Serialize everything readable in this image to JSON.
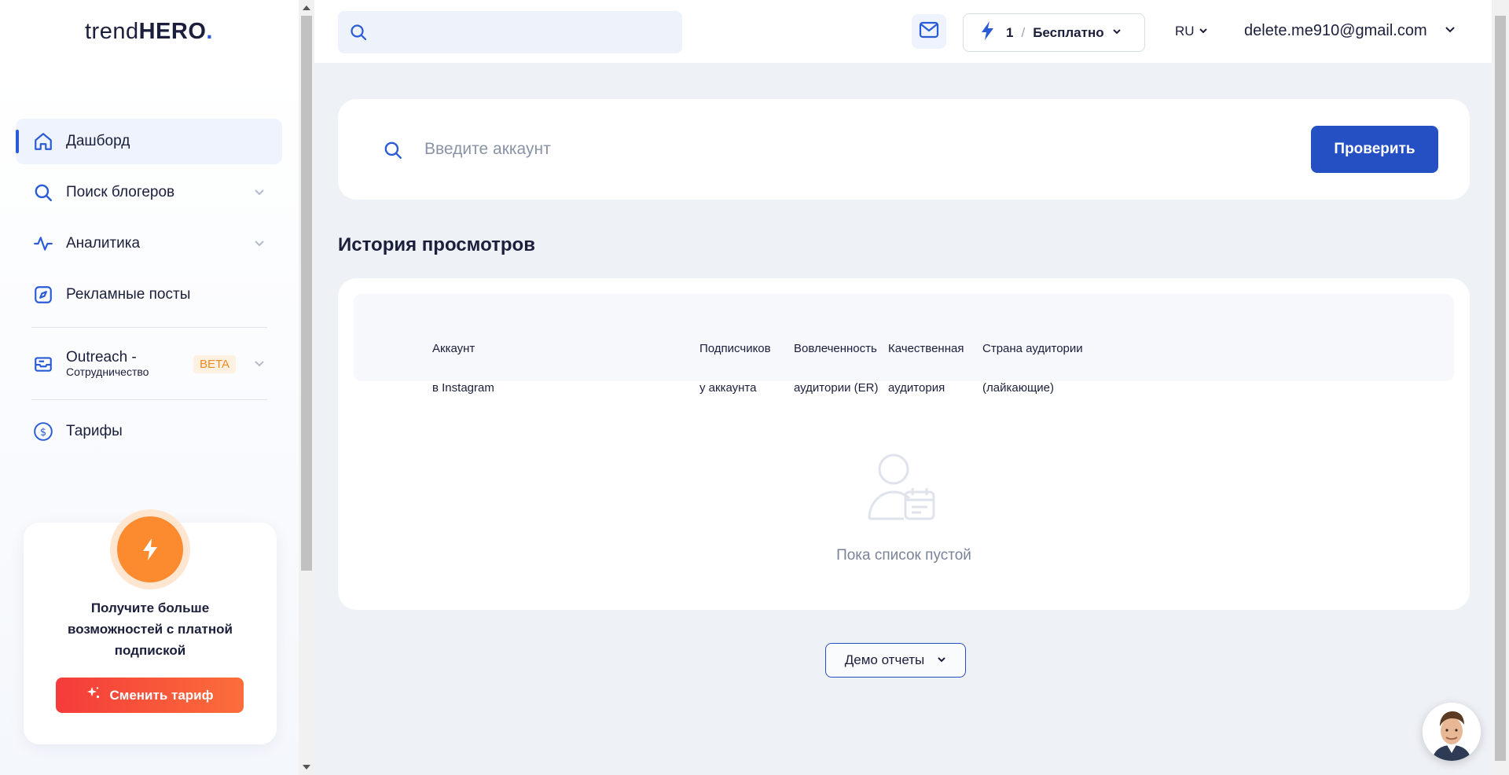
{
  "brand": {
    "logo_prefix": "trend",
    "logo_bold": "HERO",
    "logo_dot": "."
  },
  "sidebar": {
    "items": [
      {
        "label": "Дашборд",
        "icon": "home-icon",
        "active": true
      },
      {
        "label": "Поиск блогеров",
        "icon": "search-icon",
        "expandable": true
      },
      {
        "label": "Аналитика",
        "icon": "activity-icon",
        "expandable": true
      },
      {
        "label": "Рекламные посты",
        "icon": "compass-icon"
      },
      {
        "label": "Outreach -",
        "sublabel": "Сотрудничество",
        "badge": "BETA",
        "icon": "inbox-icon",
        "expandable": true
      },
      {
        "label": "Тарифы",
        "icon": "dollar-circle-icon"
      }
    ],
    "promo": {
      "text": "Получите больше возможностей с платной подпиской",
      "button": "Сменить тариф"
    }
  },
  "header": {
    "search": {
      "value": "",
      "placeholder": ""
    },
    "plan": {
      "count": "1",
      "separator": "/",
      "name": "Бесплатно"
    },
    "language": "RU",
    "user_email": "delete.me910@gmail.com"
  },
  "main": {
    "account_search": {
      "placeholder": "Введите аккаунт",
      "button": "Проверить"
    },
    "history": {
      "title": "История просмотров",
      "columns": [
        {
          "line1": "Аккаунт",
          "line2": "в Instagram"
        },
        {
          "line1": "Подписчиков",
          "line2": "у аккаунта"
        },
        {
          "line1": "Вовлеченность",
          "line2": "аудитории (ER)"
        },
        {
          "line1": "Качественная",
          "line2": "аудитория"
        },
        {
          "line1": "Страна аудитории",
          "line2": "(лайкающие)"
        }
      ],
      "empty_text": "Пока список пустой"
    },
    "demo_button": "Демо отчеты"
  },
  "colors": {
    "accent": "#2550c4",
    "promo_orange": "#fb8b2e",
    "promo_button_start": "#f53b3b",
    "promo_button_end": "#fb6e3a",
    "beta_text": "#f08a24",
    "text_dark": "#1b1f3b"
  }
}
